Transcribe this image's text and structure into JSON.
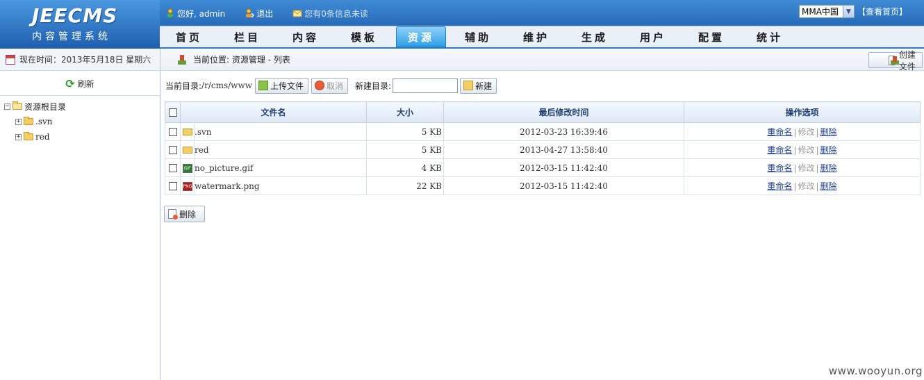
{
  "logo": {
    "main": "JEECMS",
    "sub": "内容管理系统"
  },
  "userbar": {
    "greeting": "您好, admin",
    "logout": "退出",
    "messages": "您有0条信息未读"
  },
  "lang": {
    "selected": "MMA中国",
    "view_home": "【查看首页】"
  },
  "nav": {
    "tabs": [
      {
        "label": "首页",
        "name": "tab-home"
      },
      {
        "label": "栏目",
        "name": "tab-channel"
      },
      {
        "label": "内容",
        "name": "tab-content"
      },
      {
        "label": "模板",
        "name": "tab-template"
      },
      {
        "label": "资源",
        "name": "tab-resource",
        "active": true
      },
      {
        "label": "辅助",
        "name": "tab-assist"
      },
      {
        "label": "维护",
        "name": "tab-maintain"
      },
      {
        "label": "生成",
        "name": "tab-generate"
      },
      {
        "label": "用户",
        "name": "tab-user"
      },
      {
        "label": "配置",
        "name": "tab-config"
      },
      {
        "label": "统计",
        "name": "tab-stats"
      }
    ]
  },
  "left": {
    "time_label": "现在时间：",
    "time_value": "2013年5月18日 星期六",
    "refresh": "刷新",
    "tree": {
      "root": "资源根目录",
      "children": [
        ".svn",
        "red"
      ]
    }
  },
  "main": {
    "location": "当前位置: 资源管理 - 列表",
    "create_file": "创建文件",
    "toolbar": {
      "current_dir_label": "当前目录:",
      "current_dir": "/r/cms/www",
      "upload": "上传文件",
      "cancel": "取消",
      "new_dir_label": "新建目录:",
      "new_dir_value": "",
      "new_button": "新建"
    },
    "table": {
      "headers": {
        "name": "文件名",
        "size": "大小",
        "modified": "最后修改时间",
        "ops": "操作选项"
      },
      "rows": [
        {
          "type": "folder",
          "name": ".svn",
          "size": "5 KB",
          "modified": "2012-03-23 16:39:46"
        },
        {
          "type": "folder",
          "name": "red",
          "size": "5 KB",
          "modified": "2013-04-27 13:58:40"
        },
        {
          "type": "gif",
          "name": "no_picture.gif",
          "size": "4 KB",
          "modified": "2012-03-15 11:42:40"
        },
        {
          "type": "png",
          "name": "watermark.png",
          "size": "22 KB",
          "modified": "2012-03-15 11:42:40"
        }
      ],
      "ops": {
        "rename": "重命名",
        "edit": "修改",
        "delete": "删除"
      }
    },
    "delete_button": "删除"
  },
  "watermark": "www.wooyun.org"
}
